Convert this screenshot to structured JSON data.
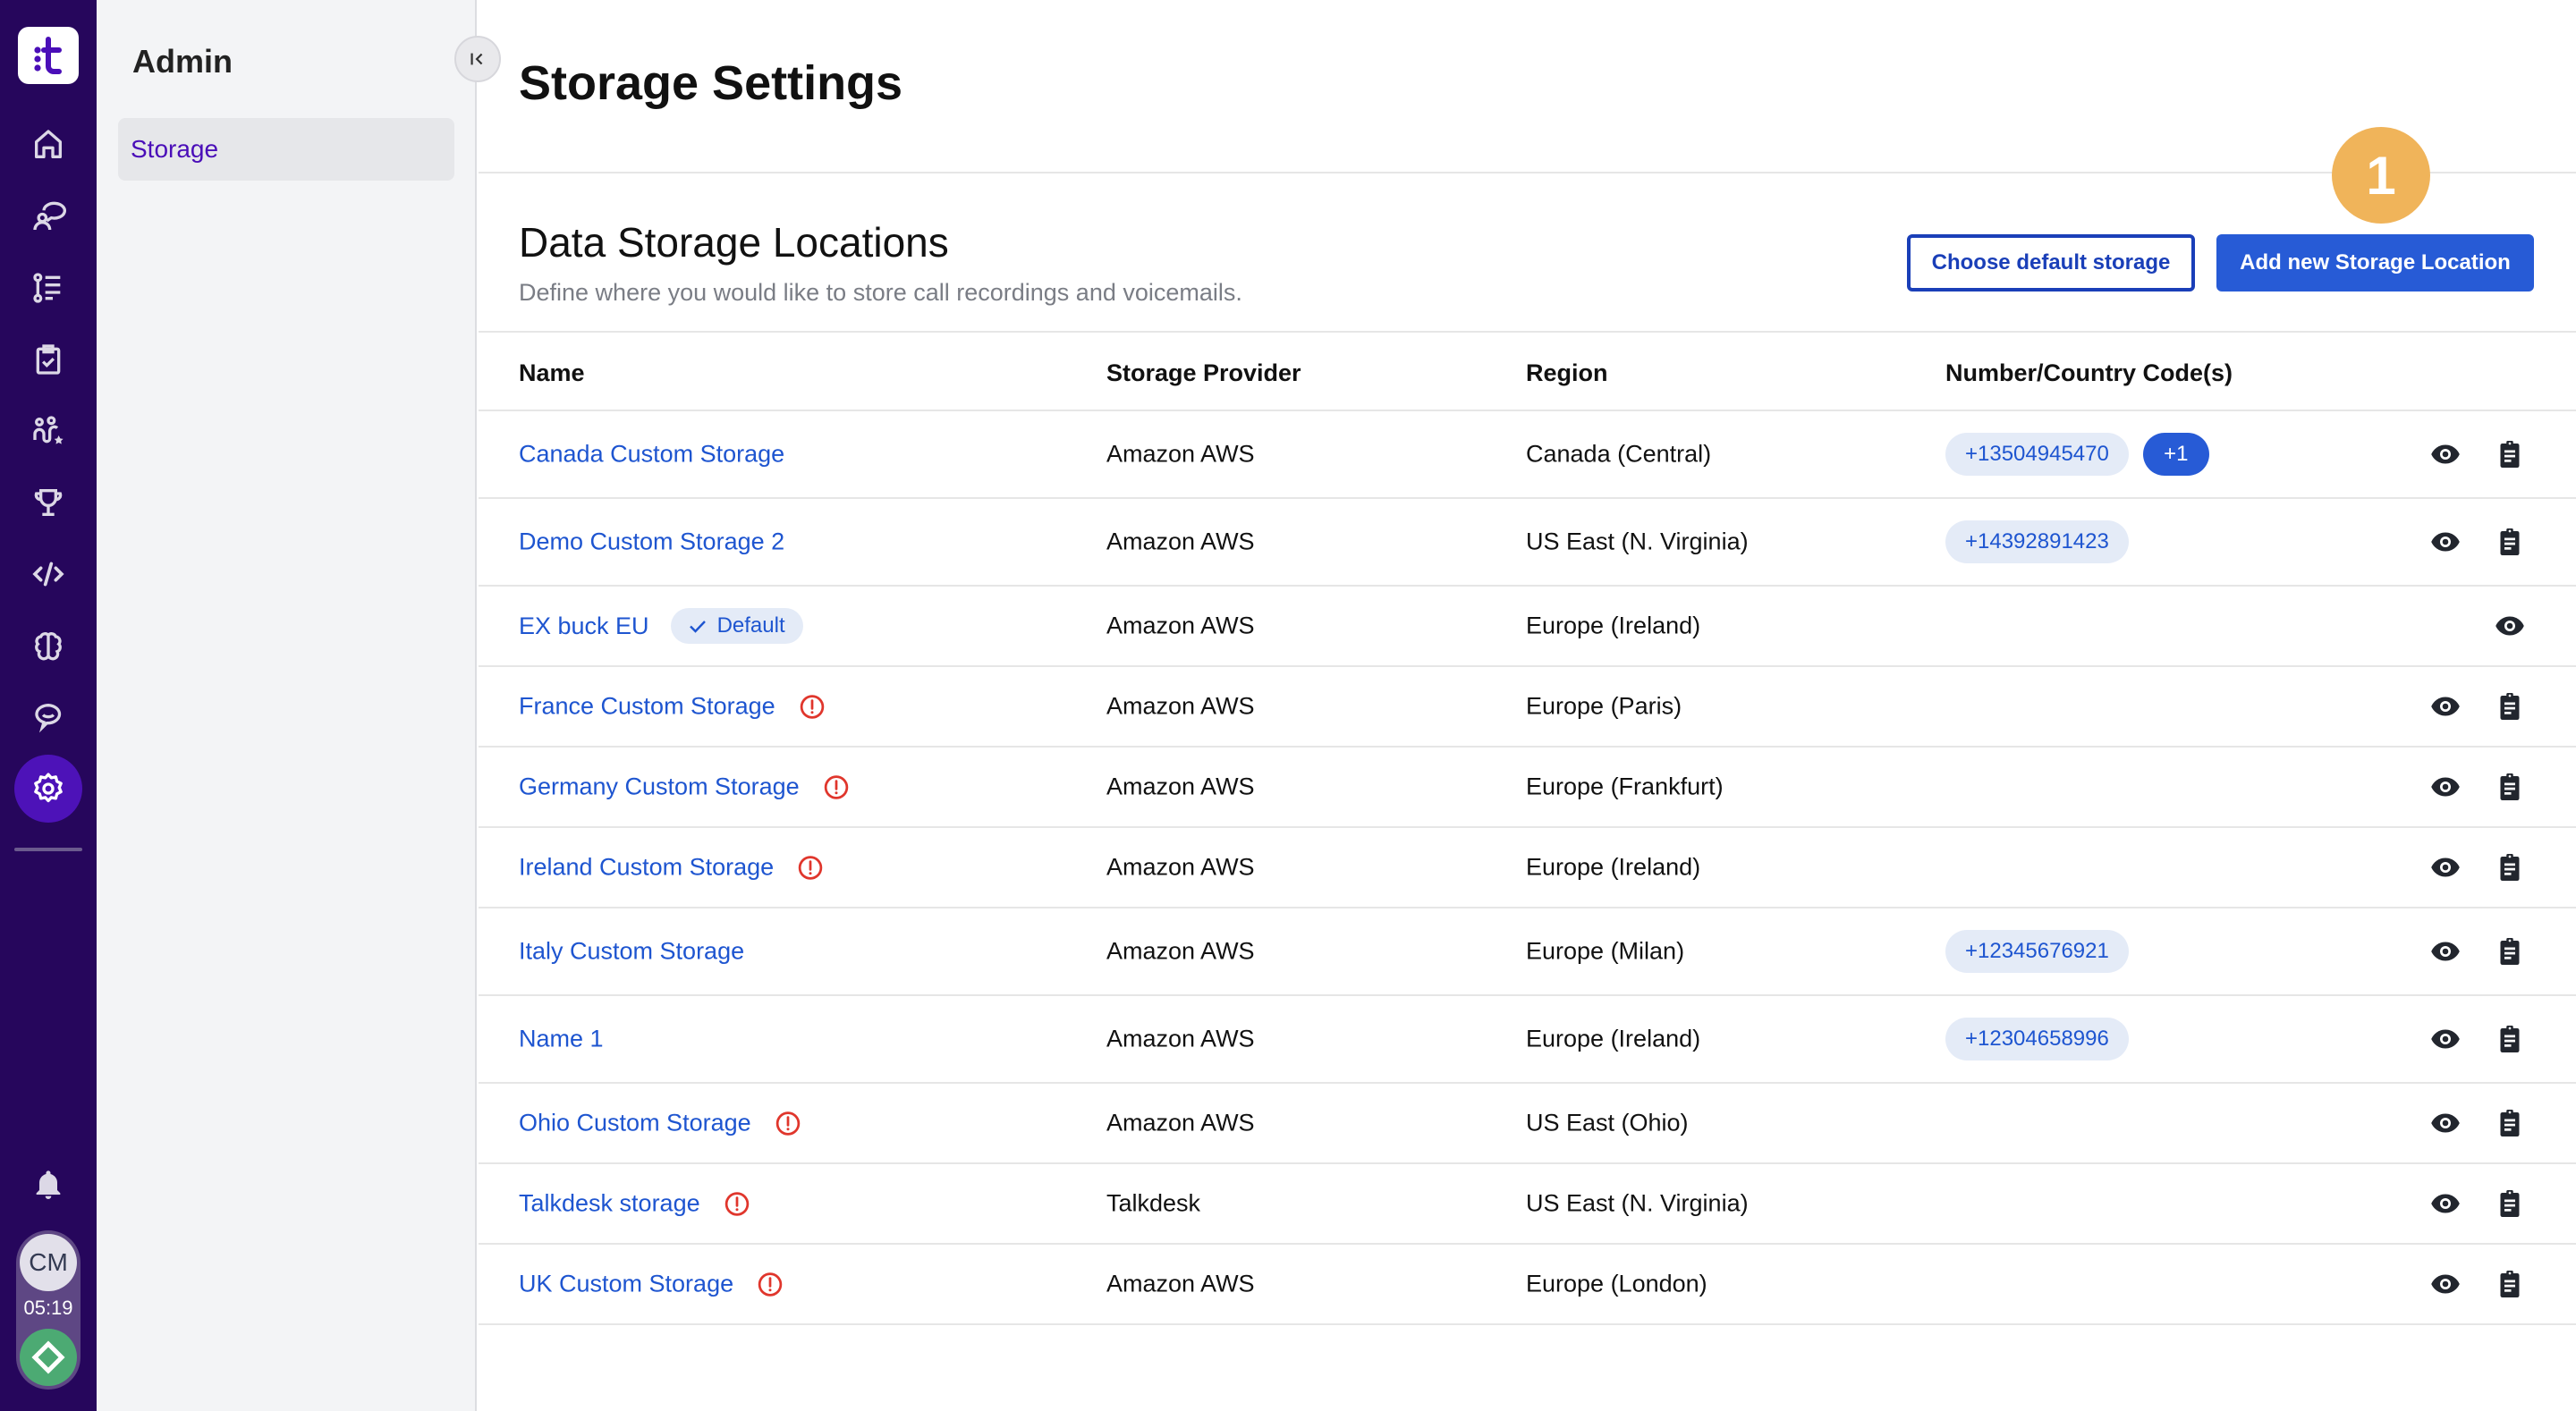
{
  "rail": {
    "logo_icon": "talkdesk-logo-icon",
    "items": [
      {
        "name": "home",
        "icon": "home-icon"
      },
      {
        "name": "conversations",
        "icon": "agent-chat-icon"
      },
      {
        "name": "workflows",
        "icon": "steps-list-icon"
      },
      {
        "name": "tasks",
        "icon": "clipboard-check-icon"
      },
      {
        "name": "journeys",
        "icon": "journey-star-icon"
      },
      {
        "name": "achievements",
        "icon": "trophy-icon"
      },
      {
        "name": "developer",
        "icon": "code-icon"
      },
      {
        "name": "ai",
        "icon": "brain-icon"
      },
      {
        "name": "chat",
        "icon": "chat-bubble-icon"
      },
      {
        "name": "admin",
        "icon": "gear-icon",
        "active": true
      }
    ],
    "notifications_icon": "bell-icon",
    "avatar_initials": "CM",
    "timer": "05:19",
    "status_icon": "available-status-icon"
  },
  "subnav": {
    "title": "Admin",
    "items": [
      {
        "label": "Storage",
        "active": true
      }
    ],
    "collapse_icon": "collapse-left-icon"
  },
  "header": {
    "title": "Storage Settings"
  },
  "section": {
    "title": "Data Storage Locations",
    "subtitle": "Define where you would like to store call recordings and voicemails.",
    "choose_default_label": "Choose default storage",
    "add_new_label": "Add new Storage Location",
    "step_badge": "1"
  },
  "table": {
    "columns": [
      "Name",
      "Storage Provider",
      "Region",
      "Number/Country Code(s)"
    ],
    "rows": [
      {
        "name": "Canada Custom Storage",
        "provider": "Amazon AWS",
        "region": "Canada (Central)",
        "numbers": [
          "+13504945470"
        ],
        "more": "+1",
        "warning": false,
        "default": false,
        "actions": [
          "view",
          "details"
        ]
      },
      {
        "name": "Demo Custom Storage 2",
        "provider": "Amazon AWS",
        "region": "US East (N. Virginia)",
        "numbers": [
          "+14392891423"
        ],
        "more": null,
        "warning": false,
        "default": false,
        "actions": [
          "view",
          "details"
        ]
      },
      {
        "name": "EX buck EU",
        "provider": "Amazon AWS",
        "region": "Europe (Ireland)",
        "numbers": [],
        "more": null,
        "warning": false,
        "default": true,
        "default_label": "Default",
        "actions": [
          "view"
        ]
      },
      {
        "name": "France Custom Storage",
        "provider": "Amazon AWS",
        "region": "Europe (Paris)",
        "numbers": [],
        "more": null,
        "warning": true,
        "default": false,
        "actions": [
          "view",
          "details"
        ]
      },
      {
        "name": "Germany Custom Storage",
        "provider": "Amazon AWS",
        "region": "Europe (Frankfurt)",
        "numbers": [],
        "more": null,
        "warning": true,
        "default": false,
        "actions": [
          "view",
          "details"
        ]
      },
      {
        "name": "Ireland Custom Storage",
        "provider": "Amazon AWS",
        "region": "Europe (Ireland)",
        "numbers": [],
        "more": null,
        "warning": true,
        "default": false,
        "actions": [
          "view",
          "details"
        ]
      },
      {
        "name": "Italy Custom Storage",
        "provider": "Amazon AWS",
        "region": "Europe (Milan)",
        "numbers": [
          "+12345676921"
        ],
        "more": null,
        "warning": false,
        "default": false,
        "actions": [
          "view",
          "details"
        ]
      },
      {
        "name": "Name 1",
        "provider": "Amazon AWS",
        "region": "Europe (Ireland)",
        "numbers": [
          "+12304658996"
        ],
        "more": null,
        "warning": false,
        "default": false,
        "actions": [
          "view",
          "details"
        ]
      },
      {
        "name": "Ohio Custom Storage",
        "provider": "Amazon AWS",
        "region": "US East (Ohio)",
        "numbers": [],
        "more": null,
        "warning": true,
        "default": false,
        "actions": [
          "view",
          "details"
        ]
      },
      {
        "name": "Talkdesk storage",
        "provider": "Talkdesk",
        "region": "US East (N. Virginia)",
        "numbers": [],
        "more": null,
        "warning": true,
        "default": false,
        "actions": [
          "view",
          "details"
        ]
      },
      {
        "name": "UK Custom Storage",
        "provider": "Amazon AWS",
        "region": "Europe (London)",
        "numbers": [],
        "more": null,
        "warning": true,
        "default": false,
        "actions": [
          "view",
          "details"
        ]
      }
    ]
  },
  "colors": {
    "rail_bg": "#26065c",
    "accent_purple": "#4a0eb8",
    "link_blue": "#1e55d0",
    "primary_button": "#275bd6",
    "warning_red": "#e0362c",
    "status_green": "#4caa73",
    "step_badge": "#f0b45a"
  }
}
